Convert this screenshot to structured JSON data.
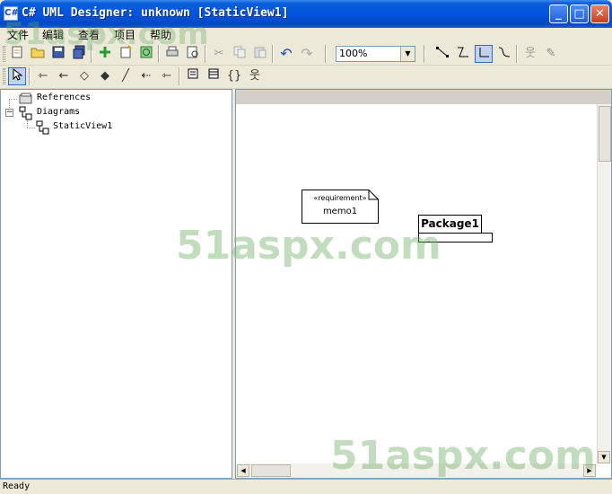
{
  "window": {
    "title": "C# UML Designer: unknown [StaticView1]",
    "app_icon": "C#",
    "minimize_glyph": "_",
    "maximize_glyph": "□",
    "close_glyph": "✕"
  },
  "menu": [
    "文件",
    "编辑",
    "查看",
    "项目",
    "帮助"
  ],
  "toolbar_main": {
    "zoom_value": "100%"
  },
  "tree": {
    "items": [
      {
        "label": "References",
        "icon": "references-icon"
      },
      {
        "label": "Diagrams",
        "icon": "diagram-folder-icon",
        "expander": "−"
      },
      {
        "label": "StaticView1",
        "icon": "static-view-icon"
      }
    ]
  },
  "canvas": {
    "memo": {
      "stereotype": "«requirement»",
      "name": "memo1"
    },
    "package": {
      "name": "Package1"
    }
  },
  "watermark": {
    "text": "51aspx.com"
  },
  "status": {
    "text": "Ready"
  }
}
